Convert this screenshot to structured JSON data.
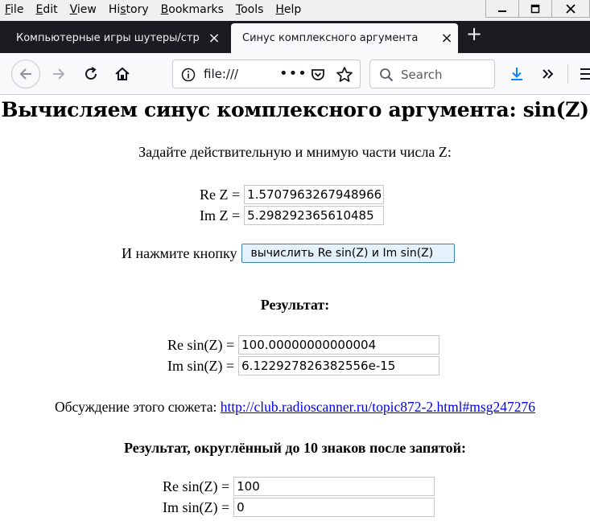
{
  "menu": {
    "items": [
      {
        "first": "F",
        "rest": "ile"
      },
      {
        "first": "E",
        "rest": "dit"
      },
      {
        "first": "V",
        "rest": "iew"
      },
      {
        "first": "",
        "rest": "Hi",
        "u": "s",
        "tail": "tory"
      },
      {
        "first": "B",
        "rest": "ookmarks"
      },
      {
        "first": "T",
        "rest": "ools"
      },
      {
        "first": "H",
        "rest": "elp"
      }
    ]
  },
  "tabs": {
    "inactive_label": "Компьютерные игры шутеры/стр",
    "active_label": "Синус комплексного аргумента"
  },
  "nav": {
    "url": "file:///",
    "search_placeholder": "Search"
  },
  "page": {
    "title": "Вычисляем синус комплексного аргумента: sin(Z)",
    "prompt": "Задайте действительную и мнимую части числа Z:",
    "re_z_label": "Re Z =",
    "re_z_value": "1.5707963267948966",
    "im_z_label": "Im Z =",
    "im_z_value": "5.298292365610485",
    "press_label": "И нажмите кнопку",
    "compute_button": "вычислить Re sin(Z) и Im sin(Z)",
    "result_heading": "Результат:",
    "re_sin_label": "Re sin(Z) =",
    "re_sin_value": "100.00000000000004",
    "im_sin_label": "Im sin(Z) =",
    "im_sin_value": "6.122927826382556e-15",
    "discussion_label": "Обсуждение этого сюжета:",
    "discussion_link": "http://club.radioscanner.ru/topic872-2.html#msg247276",
    "rounded_heading": "Результат, округлённый до 10 знаков после запятой:",
    "re_sin_rounded_label": "Re sin(Z) =",
    "re_sin_rounded_value": "100",
    "im_sin_rounded_label": "Im sin(Z) =",
    "im_sin_rounded_value": "0"
  }
}
